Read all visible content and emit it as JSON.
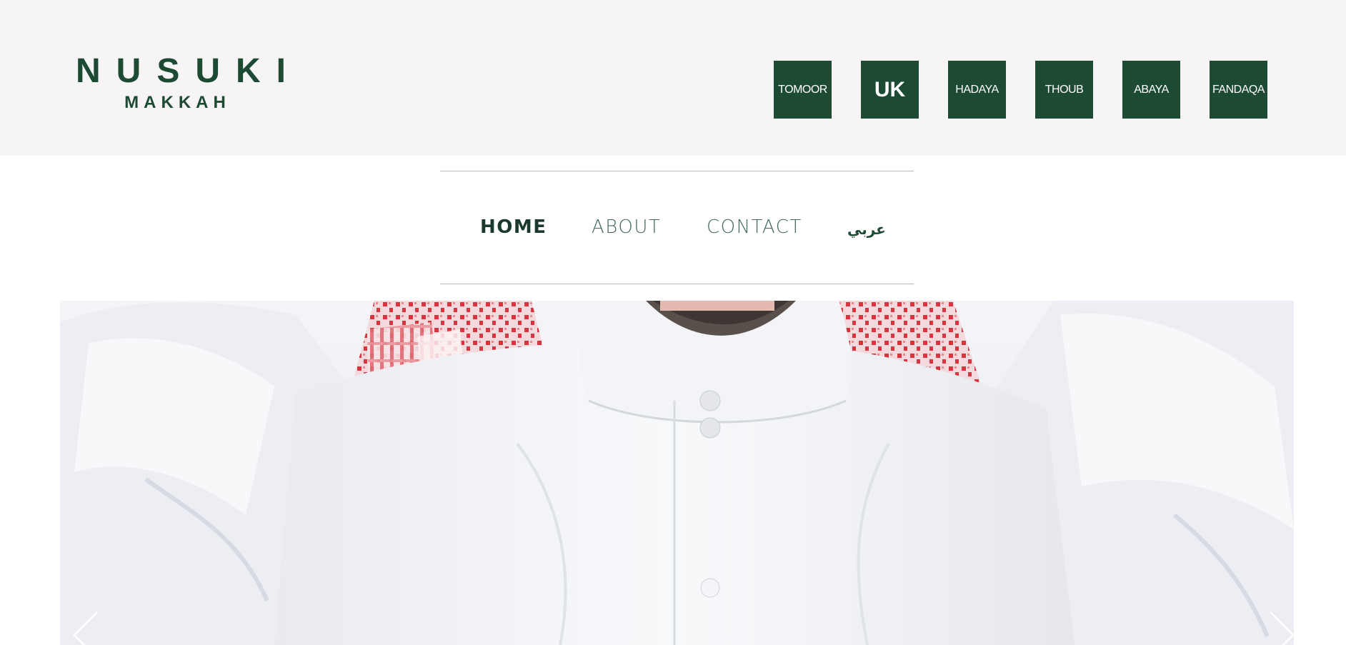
{
  "logo": {
    "main": "NUSUKI",
    "sub": "MAKKAH"
  },
  "brand_tiles": [
    {
      "label": "TOMOOR",
      "name": "tile-tomoor"
    },
    {
      "label": "UK",
      "name": "tile-uk"
    },
    {
      "label": "HADAYA",
      "name": "tile-hadaya"
    },
    {
      "label": "THOUB",
      "name": "tile-thoub"
    },
    {
      "label": "ABAYA",
      "name": "tile-abaya"
    },
    {
      "label": "FANDAQA",
      "name": "tile-fandaqa"
    }
  ],
  "nav": {
    "home": "HOME",
    "about": "ABOUT",
    "contact": "CONTACT",
    "arabic": "عربي"
  },
  "hero": {
    "icons": {
      "prev": "chevron-left-icon",
      "next": "chevron-right-icon"
    }
  },
  "colors": {
    "brand_green": "#1c4a33",
    "topbar_bg": "#f6f4f5",
    "divider": "#b9b9b9",
    "shemagh_red": "#d8343f"
  }
}
